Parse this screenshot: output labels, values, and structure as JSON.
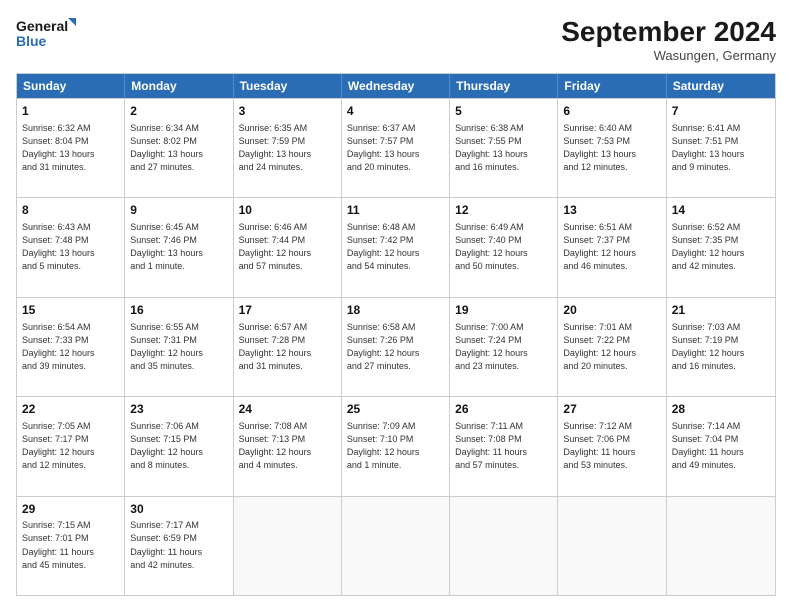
{
  "header": {
    "logo_line1": "General",
    "logo_line2": "Blue",
    "month_title": "September 2024",
    "location": "Wasungen, Germany"
  },
  "days_of_week": [
    "Sunday",
    "Monday",
    "Tuesday",
    "Wednesday",
    "Thursday",
    "Friday",
    "Saturday"
  ],
  "weeks": [
    [
      {
        "day": "1",
        "info": "Sunrise: 6:32 AM\nSunset: 8:04 PM\nDaylight: 13 hours\nand 31 minutes."
      },
      {
        "day": "2",
        "info": "Sunrise: 6:34 AM\nSunset: 8:02 PM\nDaylight: 13 hours\nand 27 minutes."
      },
      {
        "day": "3",
        "info": "Sunrise: 6:35 AM\nSunset: 7:59 PM\nDaylight: 13 hours\nand 24 minutes."
      },
      {
        "day": "4",
        "info": "Sunrise: 6:37 AM\nSunset: 7:57 PM\nDaylight: 13 hours\nand 20 minutes."
      },
      {
        "day": "5",
        "info": "Sunrise: 6:38 AM\nSunset: 7:55 PM\nDaylight: 13 hours\nand 16 minutes."
      },
      {
        "day": "6",
        "info": "Sunrise: 6:40 AM\nSunset: 7:53 PM\nDaylight: 13 hours\nand 12 minutes."
      },
      {
        "day": "7",
        "info": "Sunrise: 6:41 AM\nSunset: 7:51 PM\nDaylight: 13 hours\nand 9 minutes."
      }
    ],
    [
      {
        "day": "8",
        "info": "Sunrise: 6:43 AM\nSunset: 7:48 PM\nDaylight: 13 hours\nand 5 minutes."
      },
      {
        "day": "9",
        "info": "Sunrise: 6:45 AM\nSunset: 7:46 PM\nDaylight: 13 hours\nand 1 minute."
      },
      {
        "day": "10",
        "info": "Sunrise: 6:46 AM\nSunset: 7:44 PM\nDaylight: 12 hours\nand 57 minutes."
      },
      {
        "day": "11",
        "info": "Sunrise: 6:48 AM\nSunset: 7:42 PM\nDaylight: 12 hours\nand 54 minutes."
      },
      {
        "day": "12",
        "info": "Sunrise: 6:49 AM\nSunset: 7:40 PM\nDaylight: 12 hours\nand 50 minutes."
      },
      {
        "day": "13",
        "info": "Sunrise: 6:51 AM\nSunset: 7:37 PM\nDaylight: 12 hours\nand 46 minutes."
      },
      {
        "day": "14",
        "info": "Sunrise: 6:52 AM\nSunset: 7:35 PM\nDaylight: 12 hours\nand 42 minutes."
      }
    ],
    [
      {
        "day": "15",
        "info": "Sunrise: 6:54 AM\nSunset: 7:33 PM\nDaylight: 12 hours\nand 39 minutes."
      },
      {
        "day": "16",
        "info": "Sunrise: 6:55 AM\nSunset: 7:31 PM\nDaylight: 12 hours\nand 35 minutes."
      },
      {
        "day": "17",
        "info": "Sunrise: 6:57 AM\nSunset: 7:28 PM\nDaylight: 12 hours\nand 31 minutes."
      },
      {
        "day": "18",
        "info": "Sunrise: 6:58 AM\nSunset: 7:26 PM\nDaylight: 12 hours\nand 27 minutes."
      },
      {
        "day": "19",
        "info": "Sunrise: 7:00 AM\nSunset: 7:24 PM\nDaylight: 12 hours\nand 23 minutes."
      },
      {
        "day": "20",
        "info": "Sunrise: 7:01 AM\nSunset: 7:22 PM\nDaylight: 12 hours\nand 20 minutes."
      },
      {
        "day": "21",
        "info": "Sunrise: 7:03 AM\nSunset: 7:19 PM\nDaylight: 12 hours\nand 16 minutes."
      }
    ],
    [
      {
        "day": "22",
        "info": "Sunrise: 7:05 AM\nSunset: 7:17 PM\nDaylight: 12 hours\nand 12 minutes."
      },
      {
        "day": "23",
        "info": "Sunrise: 7:06 AM\nSunset: 7:15 PM\nDaylight: 12 hours\nand 8 minutes."
      },
      {
        "day": "24",
        "info": "Sunrise: 7:08 AM\nSunset: 7:13 PM\nDaylight: 12 hours\nand 4 minutes."
      },
      {
        "day": "25",
        "info": "Sunrise: 7:09 AM\nSunset: 7:10 PM\nDaylight: 12 hours\nand 1 minute."
      },
      {
        "day": "26",
        "info": "Sunrise: 7:11 AM\nSunset: 7:08 PM\nDaylight: 11 hours\nand 57 minutes."
      },
      {
        "day": "27",
        "info": "Sunrise: 7:12 AM\nSunset: 7:06 PM\nDaylight: 11 hours\nand 53 minutes."
      },
      {
        "day": "28",
        "info": "Sunrise: 7:14 AM\nSunset: 7:04 PM\nDaylight: 11 hours\nand 49 minutes."
      }
    ],
    [
      {
        "day": "29",
        "info": "Sunrise: 7:15 AM\nSunset: 7:01 PM\nDaylight: 11 hours\nand 45 minutes."
      },
      {
        "day": "30",
        "info": "Sunrise: 7:17 AM\nSunset: 6:59 PM\nDaylight: 11 hours\nand 42 minutes."
      },
      {
        "day": "",
        "info": ""
      },
      {
        "day": "",
        "info": ""
      },
      {
        "day": "",
        "info": ""
      },
      {
        "day": "",
        "info": ""
      },
      {
        "day": "",
        "info": ""
      }
    ]
  ]
}
